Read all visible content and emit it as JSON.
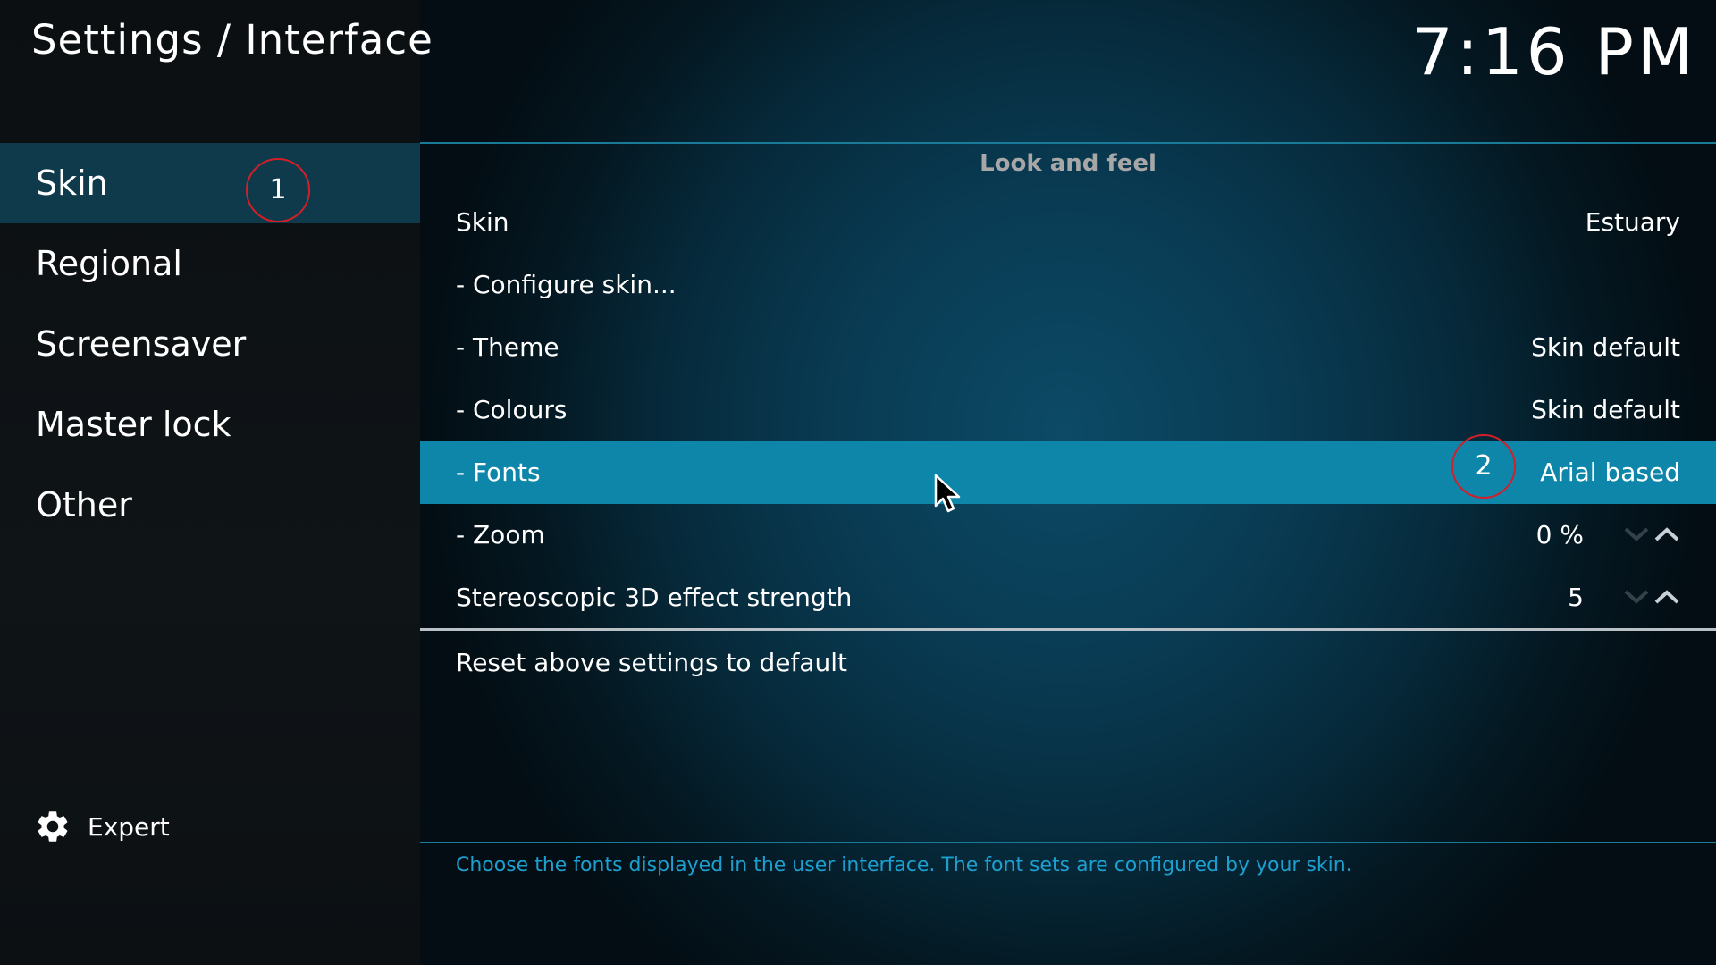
{
  "header": {
    "title": "Settings / Interface",
    "clock": "7:16 PM"
  },
  "sidebar": {
    "items": [
      {
        "label": "Skin",
        "selected": true
      },
      {
        "label": "Regional",
        "selected": false
      },
      {
        "label": "Screensaver",
        "selected": false
      },
      {
        "label": "Master lock",
        "selected": false
      },
      {
        "label": "Other",
        "selected": false
      }
    ],
    "level_button": {
      "label": "Expert",
      "icon": "gear-icon"
    }
  },
  "annotations": {
    "marker_1": "1",
    "marker_2": "2",
    "marker_color": "#d0202a"
  },
  "settings": {
    "group_title": "Look and feel",
    "rows": [
      {
        "label": "Skin",
        "value": "Estuary"
      },
      {
        "label": "- Configure skin...",
        "value": ""
      },
      {
        "label": "- Theme",
        "value": "Skin default"
      },
      {
        "label": "- Colours",
        "value": "Skin default"
      },
      {
        "label": "- Fonts",
        "value": "Arial based",
        "selected": true
      },
      {
        "label": "- Zoom",
        "value": "0 %",
        "spinner": true
      },
      {
        "label": "Stereoscopic 3D effect strength",
        "value": "5",
        "spinner": true
      }
    ],
    "reset_label": "Reset above settings to default",
    "description": "Choose the fonts displayed in the user interface. The font sets are configured by your skin."
  },
  "colors": {
    "selected_row": "#0e86aa",
    "selected_sidebar": "#0e3a4c",
    "accent_line": "#1a7b98",
    "description_text": "#1d9fd0"
  }
}
